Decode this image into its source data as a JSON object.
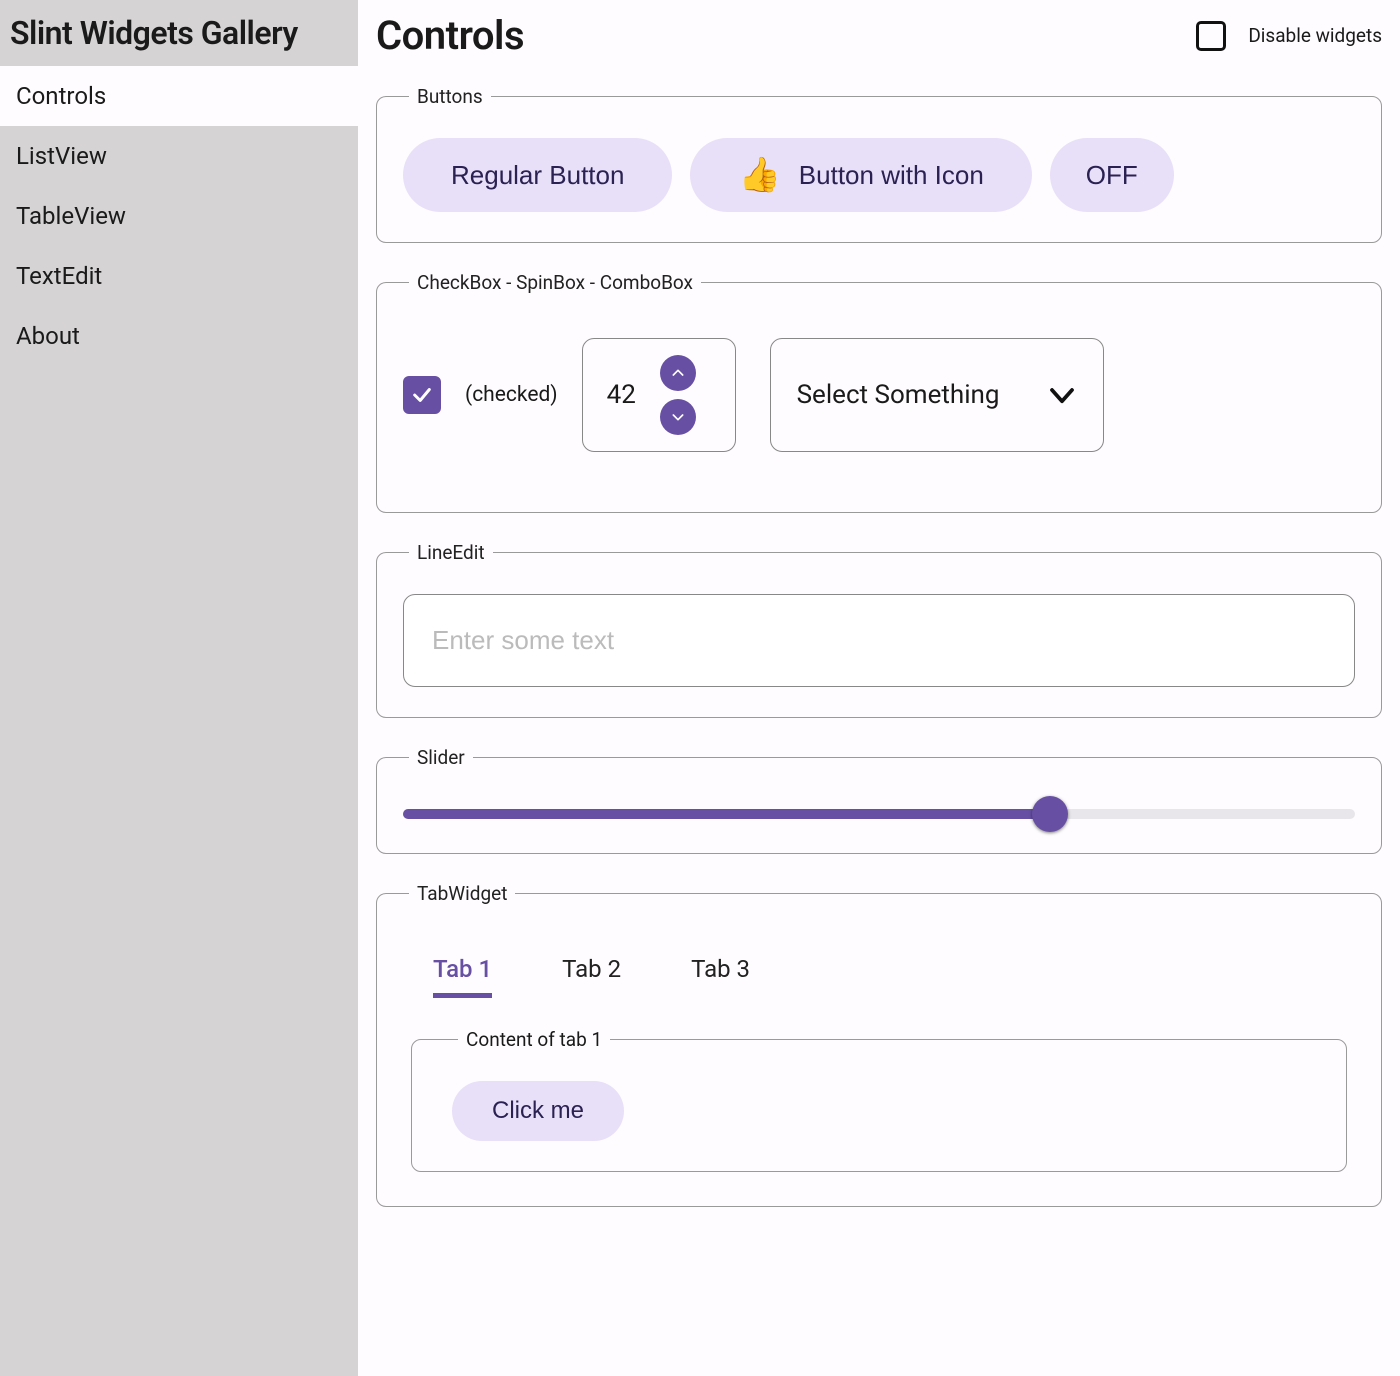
{
  "sidebar": {
    "title": "Slint Widgets Gallery",
    "items": [
      {
        "label": "Controls",
        "active": true
      },
      {
        "label": "ListView",
        "active": false
      },
      {
        "label": "TableView",
        "active": false
      },
      {
        "label": "TextEdit",
        "active": false
      },
      {
        "label": "About",
        "active": false
      }
    ]
  },
  "header": {
    "title": "Controls",
    "disable_label": "Disable widgets",
    "disable_checked": false
  },
  "groups": {
    "buttons": {
      "legend": "Buttons",
      "regular_label": "Regular Button",
      "icon_button_label": "Button with Icon",
      "icon_button_icon": "👍",
      "toggle_label": "OFF"
    },
    "checkboxes": {
      "legend": "CheckBox - SpinBox - ComboBox",
      "check_checked": true,
      "check_label": "(checked)",
      "spin_value": "42",
      "combo_label": "Select Something"
    },
    "lineedit": {
      "legend": "LineEdit",
      "placeholder": "Enter some text",
      "value": ""
    },
    "slider": {
      "legend": "Slider",
      "percent": 68
    },
    "tabwidget": {
      "legend": "TabWidget",
      "tabs": [
        {
          "label": "Tab 1",
          "active": true
        },
        {
          "label": "Tab 2",
          "active": false
        },
        {
          "label": "Tab 3",
          "active": false
        }
      ],
      "content_legend": "Content of tab 1",
      "button_label": "Click me"
    }
  },
  "colors": {
    "accent": "#6750a4",
    "button_bg": "#e8e0f8"
  }
}
